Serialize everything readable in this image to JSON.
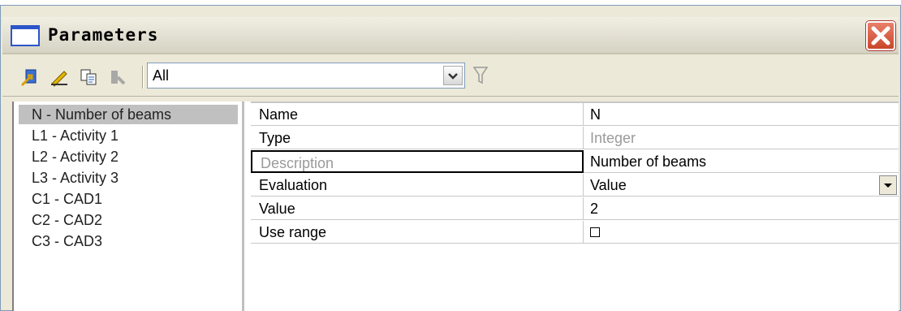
{
  "window": {
    "title": "Parameters"
  },
  "toolbar": {
    "icons": [
      "new-parameter-icon",
      "edit-icon",
      "copy-icon",
      "disabled-icon"
    ],
    "filter": {
      "value": "All"
    }
  },
  "list": {
    "items": [
      {
        "label": "N - Number of beams",
        "selected": true
      },
      {
        "label": "L1 - Activity 1"
      },
      {
        "label": "L2 - Activity 2"
      },
      {
        "label": "L3 - Activity 3"
      },
      {
        "label": "C1 - CAD1"
      },
      {
        "label": "C2 - CAD2"
      },
      {
        "label": "C3 - CAD3"
      }
    ]
  },
  "properties": {
    "rows": [
      {
        "name": "Name",
        "value": "N"
      },
      {
        "name": "Type",
        "value": "Integer"
      },
      {
        "name": "Description",
        "value": "Number of beams"
      },
      {
        "name": "Evaluation",
        "value": "Value"
      },
      {
        "name": "Value",
        "value": "2"
      },
      {
        "name": "Use range",
        "value": ""
      }
    ]
  },
  "colors": {
    "selection": "#c0c0c0",
    "close": "#c9472a",
    "title_icon": "#2b55c9"
  }
}
